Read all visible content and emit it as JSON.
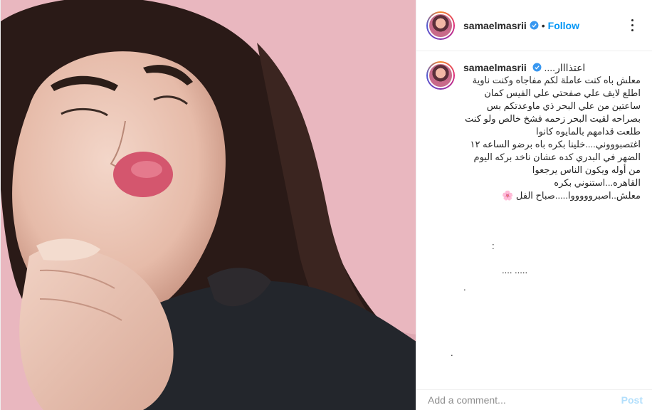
{
  "post": {
    "photo_alt": "",
    "author": {
      "username": "samaelmasrii",
      "verified": true
    },
    "header": {
      "separator": "•",
      "follow_label": "Follow"
    },
    "caption": {
      "username": "samaelmasrii",
      "lead": "....اعتذااار",
      "text": "معلش باه كنت عاملة لكم مفاجاه وكنت ناوية اطلع لايف علي صفحتي علي الفيس كمان ساعتين من علي البحر ذي ماوعدتكم بس بصراحه لقيت البحر زحمه فشخ خالص ولو كنت طلعت قدامهم بالمايوه كانوا اغتصبوووني....خلينا بكره باه برضو الساعه ١٢ الضهر في البدري كده عشان ناخد بركه اليوم من أوله ويكون الناس يرجعوا القاهره...استنوني بكره معلش..اصبروووووا.....صباح الفل 🌸"
    },
    "filler_dots": [
      ":",
      ".... .....",
      ".",
      "."
    ],
    "comment_box": {
      "placeholder": "Add a comment...",
      "post_label": "Post"
    },
    "colors": {
      "accent": "#0095f6",
      "post_disabled": "#b2dffc",
      "border": "#efefef"
    },
    "icons": [
      "verified-badge-icon",
      "more-options-icon"
    ]
  }
}
